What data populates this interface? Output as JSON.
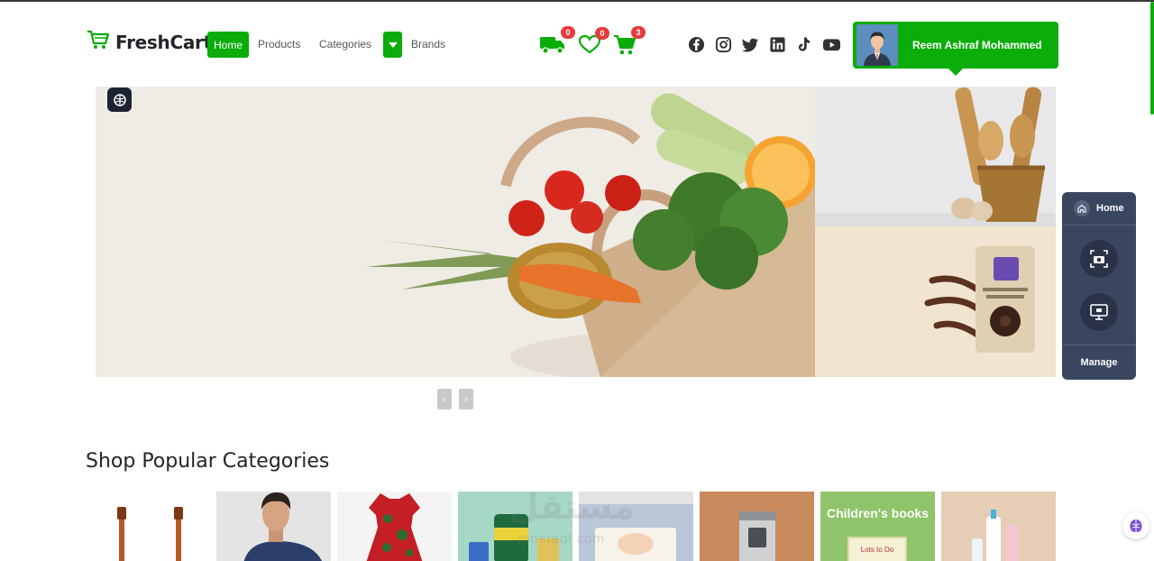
{
  "brand": {
    "name": "FreshCart"
  },
  "nav": {
    "home": "Home",
    "products": "Products",
    "categories": "Categories",
    "brands": "Brands"
  },
  "counters": {
    "delivery": "0",
    "wishlist": "0",
    "cart": "3"
  },
  "social": [
    "facebook-icon",
    "instagram-icon",
    "twitter-icon",
    "linkedin-icon",
    "tiktok-icon",
    "youtube-icon"
  ],
  "user": {
    "name": "Reem Ashraf Mohammed"
  },
  "slider": {
    "prev": "‹",
    "next": "›"
  },
  "side_panel": {
    "home": "Home",
    "manage": "Manage"
  },
  "section": {
    "title": "Shop Popular Categories"
  },
  "categories": {
    "books_label": "Children's books",
    "book_cover_text": "Lots to Do",
    "watermark": "مستقل",
    "watermark_sub": "mostaql.com"
  },
  "colors": {
    "accent": "#0aad0a",
    "badge": "#e63b3b",
    "panel": "#3a4660"
  }
}
